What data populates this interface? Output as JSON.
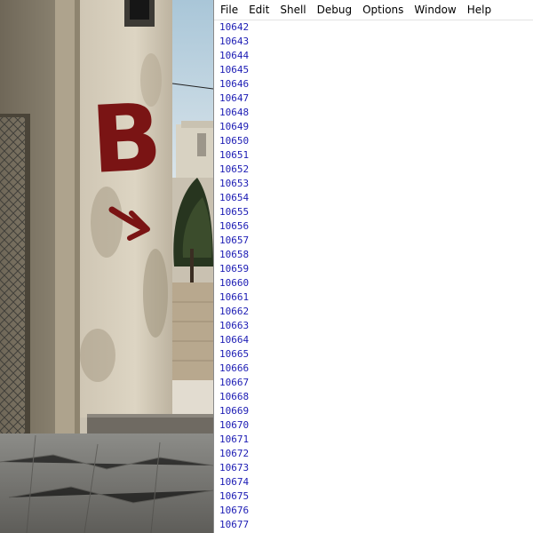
{
  "menu": {
    "items": [
      "File",
      "Edit",
      "Shell",
      "Debug",
      "Options",
      "Window",
      "Help"
    ]
  },
  "output": {
    "lines": [
      "10642",
      "10643",
      "10644",
      "10645",
      "10646",
      "10647",
      "10648",
      "10649",
      "10650",
      "10651",
      "10652",
      "10653",
      "10654",
      "10655",
      "10656",
      "10657",
      "10658",
      "10659",
      "10660",
      "10661",
      "10662",
      "10663",
      "10664",
      "10665",
      "10666",
      "10667",
      "10668",
      "10669",
      "10670",
      "10671",
      "10672",
      "10673",
      "10674",
      "10675",
      "10676",
      "10677"
    ],
    "color": "#1c1cb4"
  },
  "game": {
    "wall_letter": "B",
    "graffiti_color": "#7a1414"
  }
}
